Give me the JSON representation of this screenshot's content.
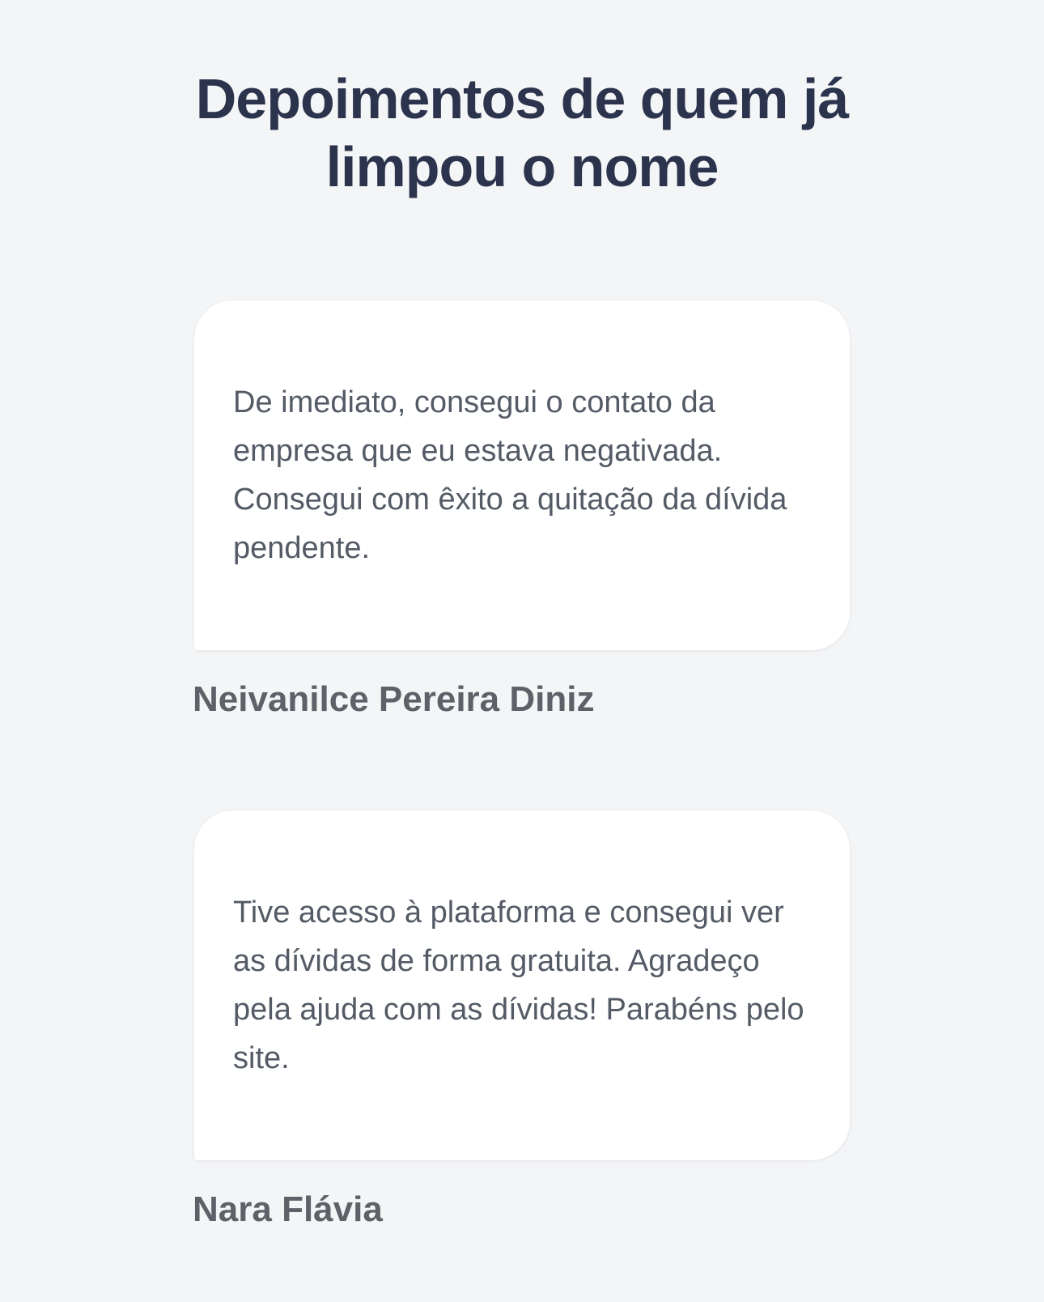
{
  "section": {
    "title": "Depoimentos de quem já limpou o nome"
  },
  "testimonials": [
    {
      "quote": "De imediato, consegui o contato da empresa que eu estava negativada. Consegui com êxito a quitação da dívida pendente.",
      "author": "Neivanilce Pereira Diniz"
    },
    {
      "quote": "Tive acesso à plataforma e consegui ver as dívidas de forma gratuita. Agradeço pela ajuda com as dívidas! Parabéns pelo site.",
      "author": "Nara Flávia"
    }
  ],
  "colors": {
    "background": "#f4f5f7",
    "title": "#2b334d",
    "card": "#ffffff",
    "quote_text": "#545b66",
    "author_text": "#5f6168"
  }
}
